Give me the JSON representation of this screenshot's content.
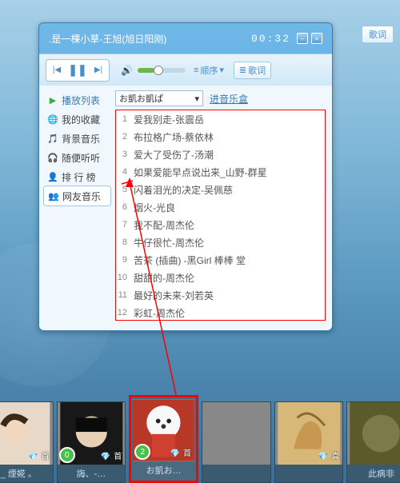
{
  "titlebar": {
    "song": ".是一棵小草-王旭(旭日阳刚)",
    "time": "00:32"
  },
  "controls": {
    "mode_label": "顺序",
    "lyric_btn": "歌词"
  },
  "side_lyric_btn": "歌词",
  "sidebar": {
    "header": "播放列表",
    "items": [
      {
        "label": "我的收藏",
        "icon": "🌐"
      },
      {
        "label": "背景音乐",
        "icon": "🎵"
      },
      {
        "label": "随便听听",
        "icon": "🎧"
      },
      {
        "label": "排 行 榜",
        "icon": "👤"
      },
      {
        "label": "网友音乐",
        "icon": "👥"
      }
    ]
  },
  "dropdown": {
    "selected": "お凱お凱ぱ"
  },
  "music_box_link": "进音乐盒",
  "songs": [
    {
      "idx": "1",
      "title": "爱我别走-张震岳"
    },
    {
      "idx": "2",
      "title": "布拉格广场-蔡依林"
    },
    {
      "idx": "3",
      "title": "爱大了受伤了-汤潮"
    },
    {
      "idx": "4",
      "title": "如果爱能早点说出来_山野-群星"
    },
    {
      "idx": "5",
      "title": "闪着泪光的决定-吴佩慈"
    },
    {
      "idx": "6",
      "title": "烟火-光良"
    },
    {
      "idx": "7",
      "title": "我不配-周杰伦"
    },
    {
      "idx": "8",
      "title": "牛仔很忙-周杰伦"
    },
    {
      "idx": "9",
      "title": "苦茶 (插曲) -黑Girl 棒棒 堂"
    },
    {
      "idx": "10",
      "title": "甜甜的-周杰伦"
    },
    {
      "idx": "11",
      "title": "最好的未来-刘若英"
    },
    {
      "idx": "12",
      "title": "彩虹-周杰伦"
    }
  ],
  "avatars": [
    {
      "name": "_ 煙婲 。",
      "badge": "",
      "count": "首",
      "bg": "#d8c8b8"
    },
    {
      "name": "誨、-…",
      "badge": "0",
      "count": "首",
      "bg": "#222"
    },
    {
      "name": "お凱お…",
      "badge": "2",
      "count": "首",
      "bg": "#c84030",
      "selected": true
    },
    {
      "name": "",
      "badge": "",
      "count": "",
      "bg": "#888"
    },
    {
      "name": "",
      "badge": "",
      "count": "真",
      "bg": "#c8a060"
    },
    {
      "name": "此病非",
      "badge": "",
      "count": "",
      "bg": "#6a6a3a"
    }
  ]
}
